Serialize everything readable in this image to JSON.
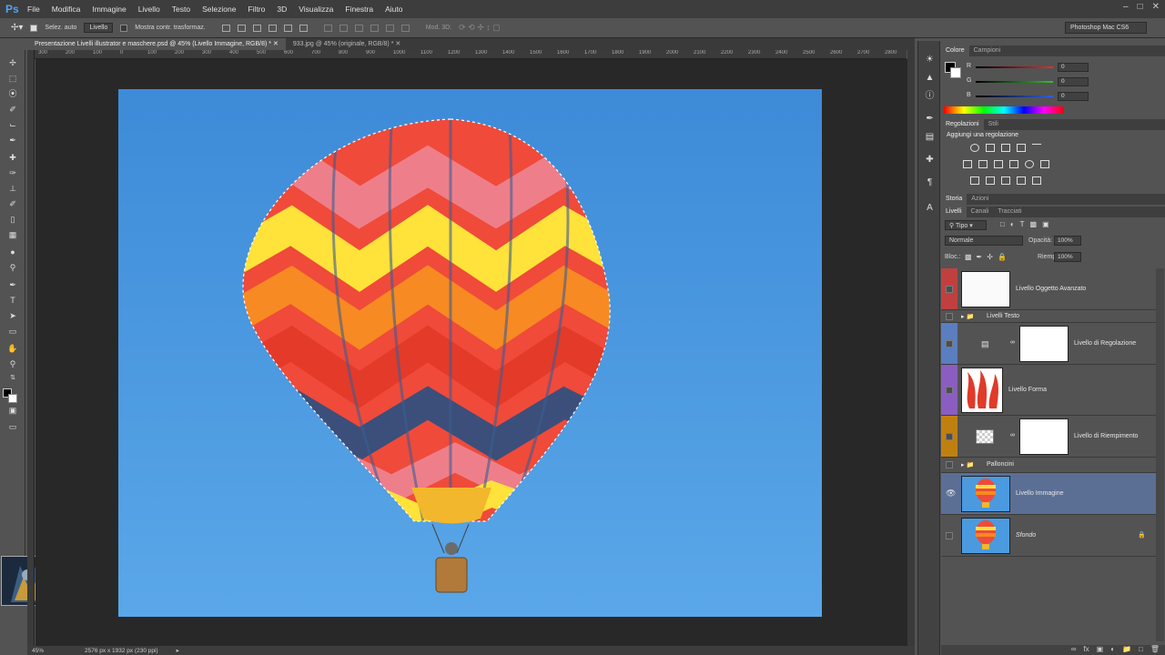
{
  "app": {
    "logo": "Ps",
    "workspace": "Photoshop Mac CS6"
  },
  "menu": [
    "File",
    "Modifica",
    "Immagine",
    "Livello",
    "Testo",
    "Selezione",
    "Filtro",
    "3D",
    "Visualizza",
    "Finestra",
    "Aiuto"
  ],
  "options": {
    "auto_select_label": "Selez. auto",
    "auto_select_target": "Livello",
    "show_transform_label": "Mostra contr. trasformaz.",
    "mode_3d_label": "Mod. 3D:"
  },
  "tabs": [
    {
      "label": "Presentazione Livelli illustrator e maschere.psd @ 45% (Livello Immagine, RGB/8) *",
      "active": true
    },
    {
      "label": "933.jpg @ 45% (originale, RGB/8) *",
      "active": false
    }
  ],
  "ruler_ticks": [
    "300",
    "200",
    "100",
    "0",
    "100",
    "200",
    "300",
    "400",
    "500",
    "600",
    "700",
    "800",
    "900",
    "1000",
    "1100",
    "1200",
    "1300",
    "1400",
    "1500",
    "1600",
    "1700",
    "1800",
    "1900",
    "2000",
    "2100",
    "2200",
    "2300",
    "2400",
    "2500",
    "2600",
    "2700",
    "2800"
  ],
  "status": {
    "zoom": "45%",
    "doc_info": "2576 px x 1932 px (230 ppi)"
  },
  "color_panel": {
    "tabs": [
      "Colore",
      "Campioni"
    ],
    "channels": [
      {
        "label": "R",
        "value": "0",
        "color": "#e23030"
      },
      {
        "label": "G",
        "value": "0",
        "color": "#30c030"
      },
      {
        "label": "B",
        "value": "0",
        "color": "#3060e0"
      }
    ]
  },
  "adjust_panel": {
    "tabs": [
      "Regolazioni",
      "Stili"
    ],
    "heading": "Aggiungi una regolazione"
  },
  "history_panel": {
    "tabs": [
      "Storia",
      "Azioni"
    ]
  },
  "layers_panel": {
    "tabs": [
      "Livelli",
      "Canali",
      "Tracciati"
    ],
    "filter": "Tipo",
    "blend_mode": "Normale",
    "opacity_label": "Opacità:",
    "opacity_value": "100%",
    "lock_label": "Bloc.:",
    "fill_label": "Riempi.:",
    "fill_value": "100%",
    "layers": [
      {
        "name": "Livello Oggetto Avanzato",
        "color": "#c04040"
      },
      {
        "name": "Livelli Testo",
        "color": ""
      },
      {
        "name": "Livello di Regolazione",
        "color": "#5a7ec0"
      },
      {
        "name": "Livello Forma",
        "color": "#8a5ec0"
      },
      {
        "name": "Livello di Riempimento",
        "color": "#c08010"
      },
      {
        "name": "Palloncini",
        "color": ""
      },
      {
        "name": "Livello Immagine",
        "color": "",
        "selected": true
      },
      {
        "name": "Sfondo",
        "color": ""
      }
    ]
  },
  "colors": {
    "accent": "#4fa3f7",
    "selected_layer": "#5b6f94",
    "sky_top": "#3d8bd8",
    "sky_bottom": "#5aa7e8"
  }
}
